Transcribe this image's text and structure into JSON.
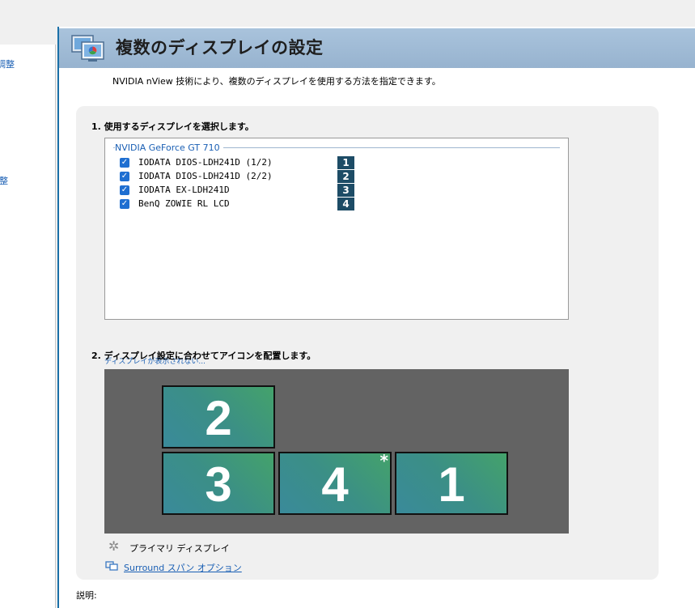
{
  "sidebar": {
    "items": [
      {
        "label": "調整"
      },
      {
        "label": "調整"
      }
    ]
  },
  "header": {
    "title": "複数のディスプレイの設定"
  },
  "subtitle": "NVIDIA nView 技術により、複数のディスプレイを使用する方法を指定できます。",
  "section1": {
    "title": "1. 使用するディスプレイを選択します。",
    "group_label": "NVIDIA GeForce GT 710",
    "displays": [
      {
        "name": "IODATA DIOS-LDH241D (1/2)",
        "number": "1",
        "checked": true
      },
      {
        "name": "IODATA DIOS-LDH241D (2/2)",
        "number": "2",
        "checked": true
      },
      {
        "name": "IODATA EX-LDH241D",
        "number": "3",
        "checked": true
      },
      {
        "name": "BenQ ZOWIE RL LCD",
        "number": "4",
        "checked": true
      }
    ],
    "not_shown_link": "ディスプレイが表示されない..."
  },
  "section2": {
    "title": "2. ディスプレイ設定に合わせてアイコンを配置します。",
    "tiles": [
      {
        "number": "2",
        "primary": false
      },
      {
        "number": "3",
        "primary": false
      },
      {
        "number": "4",
        "primary": true
      },
      {
        "number": "1",
        "primary": false
      }
    ],
    "primary_marker": "*",
    "primary_legend": "プライマリ ディスプレイ",
    "surround_link": "Surround スパン オプション"
  },
  "description_label": "説明:",
  "icons": {
    "header": "multi-display-icon",
    "checkbox": "check-icon",
    "legend": "star-icon",
    "surround": "surround-icon"
  },
  "colors": {
    "header_bar": "#a9c3dc",
    "link": "#1a5fb4",
    "badge": "#1d4c66",
    "arrange_bg": "#636363",
    "checkbox": "#1f6fd1"
  }
}
